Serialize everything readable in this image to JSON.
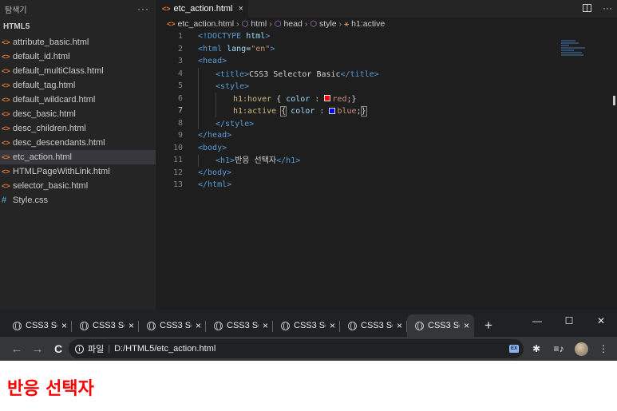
{
  "vscode": {
    "explorer": {
      "title": "탐색기",
      "more": "···",
      "folder": "HTML5",
      "files": [
        {
          "name": "attribute_basic.html",
          "type": "html"
        },
        {
          "name": "default_id.html",
          "type": "html"
        },
        {
          "name": "default_multiClass.html",
          "type": "html"
        },
        {
          "name": "default_tag.html",
          "type": "html"
        },
        {
          "name": "default_wildcard.html",
          "type": "html"
        },
        {
          "name": "desc_basic.html",
          "type": "html"
        },
        {
          "name": "desc_children.html",
          "type": "html"
        },
        {
          "name": "desc_descendants.html",
          "type": "html"
        },
        {
          "name": "etc_action.html",
          "type": "html",
          "active": true
        },
        {
          "name": "HTMLPageWithLink.html",
          "type": "html"
        },
        {
          "name": "selector_basic.html",
          "type": "html"
        },
        {
          "name": "Style.css",
          "type": "css"
        }
      ]
    },
    "tab": {
      "label": "etc_action.html",
      "close": "×"
    },
    "editor_actions": {
      "more": "···"
    },
    "breadcrumb": {
      "file": "etc_action.html",
      "items": [
        "html",
        "head",
        "style",
        "h1:active"
      ]
    },
    "line_numbers": [
      "1",
      "2",
      "3",
      "4",
      "5",
      "6",
      "7",
      "8",
      "9",
      "10",
      "11",
      "12",
      "13"
    ],
    "current_line": "7",
    "code": {
      "l1_doctype": "<!DOCTYPE ",
      "l1_html": "html",
      "l1_close": ">",
      "l2_open": "<html ",
      "l2_attr": "lang",
      "l2_eq": "=",
      "l2_val": "\"en\"",
      "l2_close": ">",
      "l3": "<head>",
      "l4_open": "<title>",
      "l4_text": "CSS3 Selector Basic",
      "l4_close": "</title>",
      "l5": "<style>",
      "l6_sel": "h1:hover",
      "l6_rest": " { ",
      "l6_prop": "color",
      "l6_colon": " : ",
      "l6_val": "red",
      "l6_end": ";}",
      "l7_sel": "h1:active",
      "l7_sp": " ",
      "l7_open": "{",
      "l7_sp2": " ",
      "l7_prop": "color",
      "l7_colon": " : ",
      "l7_val": "blue",
      "l7_semi": ";",
      "l7_end": "}",
      "l8": "</style>",
      "l9": "</head>",
      "l10": "<body>",
      "l11_open": "<h1>",
      "l11_text": "반응 선택자",
      "l11_close": "</h1>",
      "l12": "</body>",
      "l13": "</html>"
    },
    "swatch_colors": {
      "red": "#ff0000",
      "blue": "#0000ff"
    }
  },
  "chrome": {
    "tabs": [
      {
        "title": "CSS3 Se",
        "close": "×"
      },
      {
        "title": "CSS3 Se",
        "close": "×"
      },
      {
        "title": "CSS3 Se",
        "close": "×"
      },
      {
        "title": "CSS3 Se",
        "close": "×"
      },
      {
        "title": "CSS3 Se",
        "close": "×"
      },
      {
        "title": "CSS3 Se",
        "close": "×"
      },
      {
        "title": "CSS3 Se",
        "close": "×",
        "active": true
      }
    ],
    "new_tab": "+",
    "window": {
      "minimize": "—",
      "maximize": "☐",
      "close": "✕"
    },
    "nav": {
      "back": "←",
      "forward": "→",
      "reload": "C"
    },
    "omnibox": {
      "info": "i",
      "scheme_label": "파일",
      "separator": "|",
      "url": "D:/HTML5/etc_action.html"
    },
    "star": "☆",
    "extensions": {
      "ext1": "EX",
      "puzzle": "✱",
      "media": "≡♪",
      "menu": "⋮"
    },
    "page": {
      "heading": "반응 선택자",
      "heading_color": "#ff0000"
    }
  }
}
